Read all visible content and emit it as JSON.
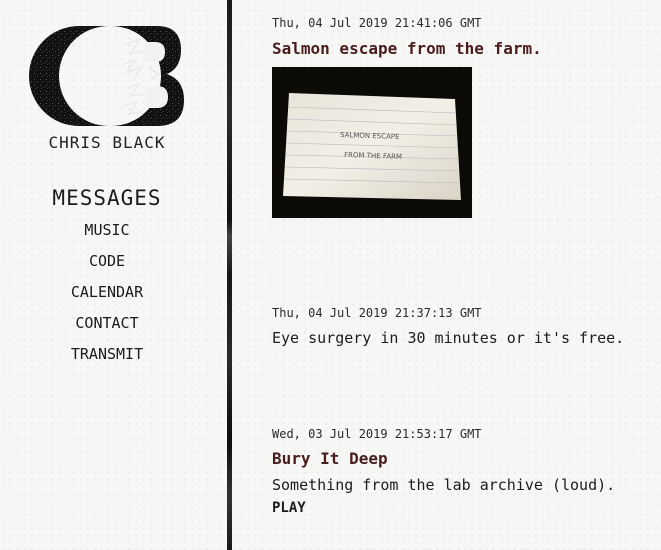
{
  "site": {
    "name": "CHRIS BLACK",
    "logo_icon": "cb-monogram-logo"
  },
  "nav": {
    "heading": "MESSAGES",
    "items": [
      {
        "label": "MUSIC"
      },
      {
        "label": "CODE"
      },
      {
        "label": "CALENDAR"
      },
      {
        "label": "CONTACT"
      },
      {
        "label": "TRANSMIT"
      }
    ]
  },
  "posts": [
    {
      "date": "Thu, 04 Jul 2019 21:41:06 GMT",
      "title": "Salmon escape from the farm.",
      "image": "index-card-photo",
      "image_text": [
        "SALMON ESCAPE",
        "FROM THE FARM"
      ]
    },
    {
      "date": "Thu, 04 Jul 2019 21:37:13 GMT",
      "body": "Eye surgery in 30 minutes or it's free."
    },
    {
      "date": "Wed, 03 Jul 2019 21:53:17 GMT",
      "title": "Bury It Deep",
      "body": "Something from the lab archive (loud).",
      "action": "PLAY"
    }
  ],
  "colors": {
    "title": "#4a1d1d",
    "divider": "#1a1a1a",
    "background": "#f7f7f6"
  }
}
